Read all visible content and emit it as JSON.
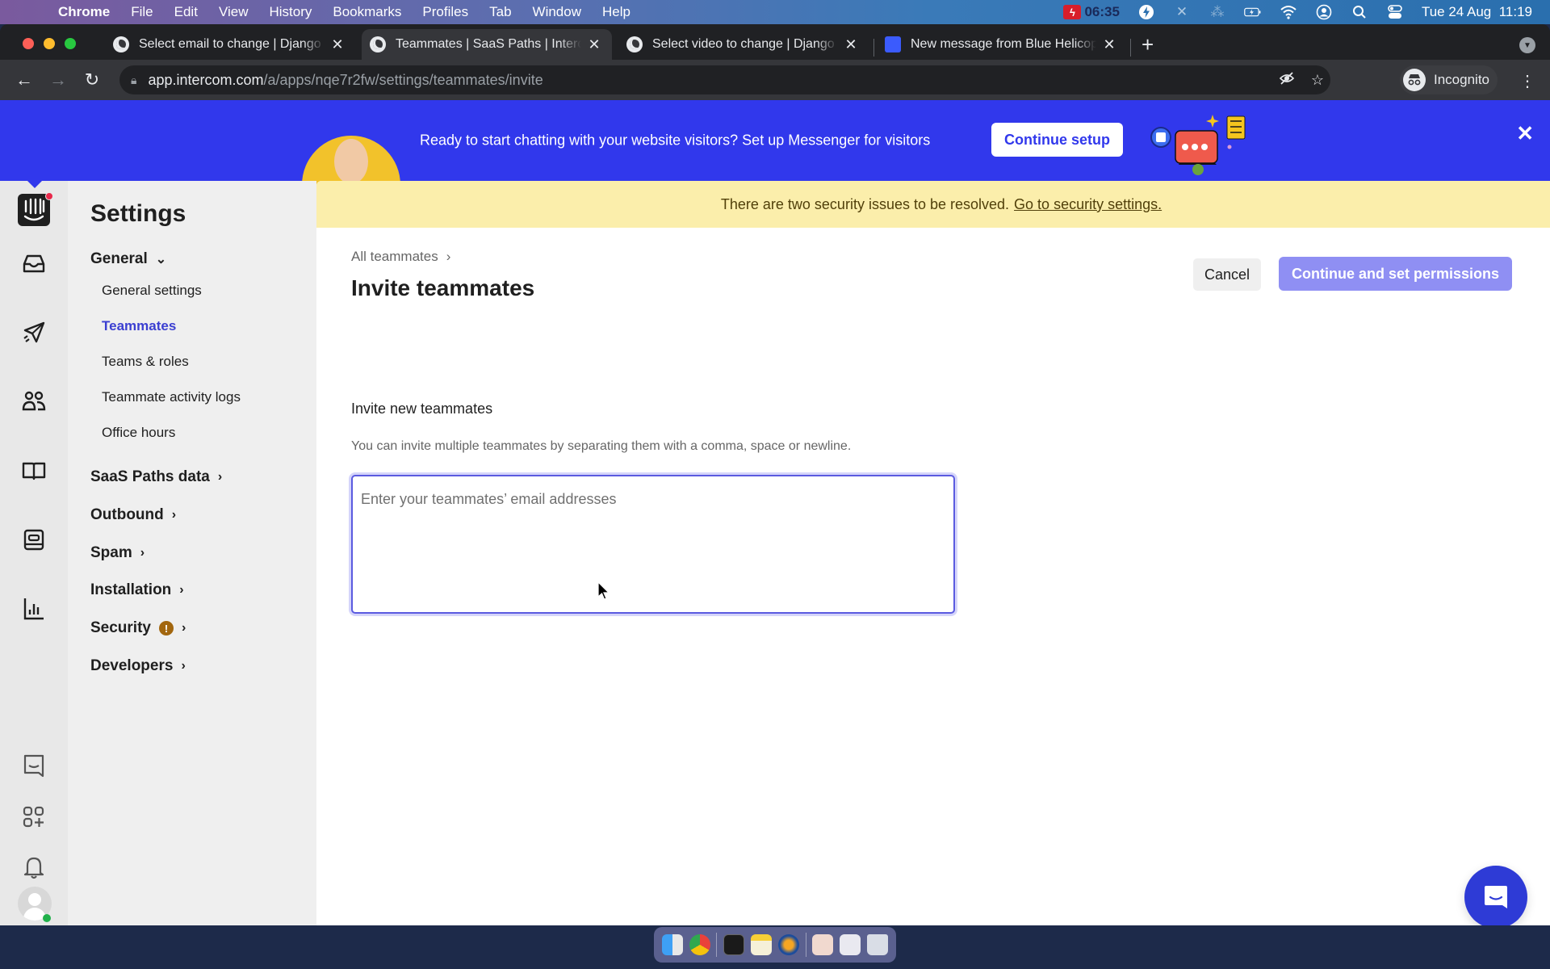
{
  "menubar": {
    "app_name": "Chrome",
    "menus": [
      "File",
      "Edit",
      "View",
      "History",
      "Bookmarks",
      "Profiles",
      "Tab",
      "Window",
      "Help"
    ],
    "recording_time": "06:35",
    "datetime": "Tue 24 Aug  11:19"
  },
  "browser": {
    "tabs": [
      {
        "title": "Select email to change | Django",
        "icon": "globe-icon",
        "active": false
      },
      {
        "title": "Teammates | SaaS Paths | Intercom",
        "icon": "globe-icon",
        "active": true
      },
      {
        "title": "Select video to change | Django",
        "icon": "globe-icon",
        "active": false
      },
      {
        "title": "New message from Blue Helicopter",
        "icon": "intercom-icon",
        "active": false
      }
    ],
    "url_host": "app.intercom.com",
    "url_path": "/a/apps/nqe7r2fw/settings/teammates/invite",
    "profile_label": "Incognito"
  },
  "banner": {
    "message": "Ready to start chatting with your website visitors? Set up Messenger for visitors",
    "cta_label": "Continue setup",
    "brand_color": "#3138ec"
  },
  "settings_nav": {
    "title": "Settings",
    "sections": [
      {
        "label": "General",
        "expanded": true,
        "items": [
          {
            "label": "General settings",
            "active": false
          },
          {
            "label": "Teammates",
            "active": true
          },
          {
            "label": "Teams & roles",
            "active": false
          },
          {
            "label": "Teammate activity logs",
            "active": false
          },
          {
            "label": "Office hours",
            "active": false
          }
        ]
      },
      {
        "label": "SaaS Paths data",
        "expanded": false
      },
      {
        "label": "Outbound",
        "expanded": false
      },
      {
        "label": "Spam",
        "expanded": false
      },
      {
        "label": "Installation",
        "expanded": false
      },
      {
        "label": "Security",
        "expanded": false,
        "warning": true
      },
      {
        "label": "Developers",
        "expanded": false
      }
    ]
  },
  "security_notice": {
    "text": "There are two security issues to be resolved.",
    "link": "Go to security settings."
  },
  "page": {
    "breadcrumb": "All teammates",
    "title": "Invite teammates",
    "cancel_label": "Cancel",
    "continue_label": "Continue and set permissions",
    "section_label": "Invite new teammates",
    "helper_text": "You can invite multiple teammates by separating them with a comma, space or newline.",
    "email_input_value": "",
    "email_input_placeholder": "Enter your teammates’ email addresses"
  }
}
